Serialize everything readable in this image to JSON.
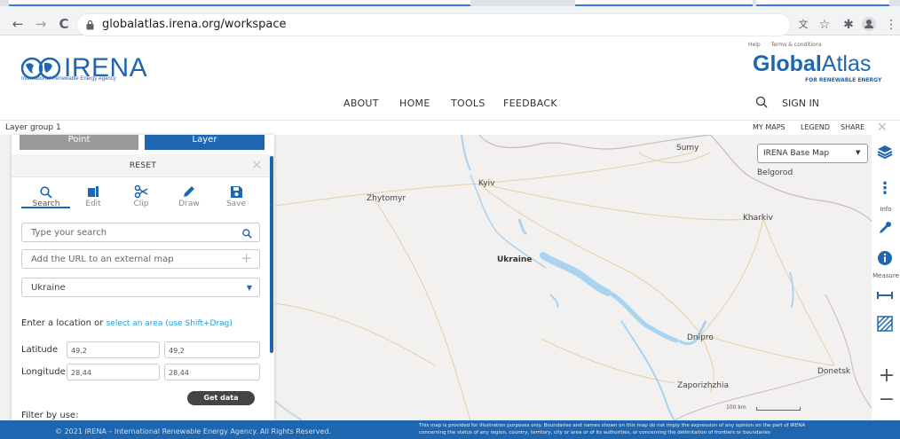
{
  "browser": {
    "url": "globalatlas.irena.org/workspace",
    "back": "←",
    "forward": "→",
    "reload": "C"
  },
  "header": {
    "irena_word": "IRENA",
    "irena_sub": "International Renewable Energy Agency",
    "help": "Help",
    "terms": "Terms & conditions",
    "ga_bold": "Global",
    "ga_light": "Atlas",
    "ga_sub": "FOR RENEWABLE ENERGY",
    "nav": [
      "ABOUT",
      "HOME",
      "TOOLS",
      "FEEDBACK"
    ],
    "signin": "SIGN IN"
  },
  "layer_bar": {
    "group": "Layer group 1",
    "links": [
      "MY MAPS",
      "LEGEND",
      "SHARE"
    ]
  },
  "panel": {
    "mode_point": "Point",
    "mode_layer": "Layer",
    "reset": "RESET",
    "tools": [
      {
        "label": "Search",
        "icon": "search-icon"
      },
      {
        "label": "Edit",
        "icon": "edit-icon"
      },
      {
        "label": "Clip",
        "icon": "scissors-icon"
      },
      {
        "label": "Draw",
        "icon": "pencil-icon"
      },
      {
        "label": "Save",
        "icon": "save-icon"
      }
    ],
    "search_placeholder": "Type your search",
    "url_placeholder": "Add the URL to an external map",
    "country": "Ukraine",
    "location_prompt": "Enter a location or",
    "location_link": "select an area (use Shift+Drag)",
    "latitude_label": "Latitude",
    "longitude_label": "Longitude",
    "lat1": "49,2",
    "lat2": "49,2",
    "lon1": "28,44",
    "lon2": "28,44",
    "get_data": "Get data",
    "filter_label": "Filter by use:"
  },
  "map": {
    "cities": [
      "Sumy",
      "Belgorod",
      "Kyiv",
      "Zhytomyr",
      "Kharkiv",
      "Ukraine",
      "Dnipro",
      "Donetsk",
      "Zaporizhzhia"
    ],
    "basemap": "IRENA Base Map",
    "info": "Info",
    "measure": "Measure",
    "scale": "100 km"
  },
  "footer": {
    "copyright": "© 2021 IRENA – International Renewable Energy Agency. All Rights Reserved.",
    "disclaimer_1": "This map is provided for illustration purposes only. Boundaries and names shown on this map do not imply the expression of any opinion on the part of IRENA",
    "disclaimer_2": "concerning the status of any region, country, territory, city or area or of its authorities, or concerning the delimitation of frontiers or boundaries"
  },
  "colors": {
    "brand": "#1f66b1",
    "map_bg": "#f2f1ef",
    "water": "#aad3f2"
  }
}
